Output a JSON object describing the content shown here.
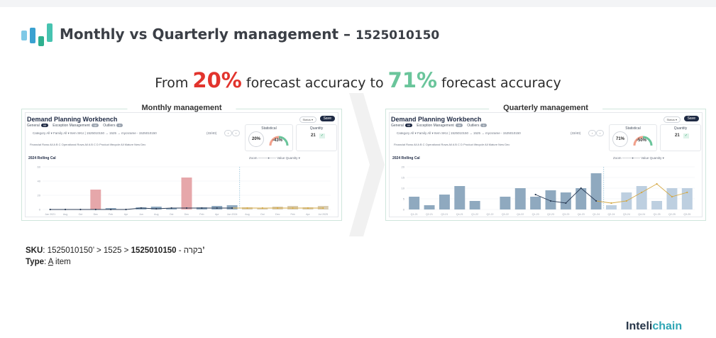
{
  "header": {
    "title": "Monthly vs Quarterly management –",
    "sku_number": "1525010150"
  },
  "headline": {
    "prefix": "From",
    "from_value": "20%",
    "middle": "forecast accuracy to",
    "to_value": "71%",
    "suffix": "forecast accuracy"
  },
  "colors": {
    "logo": [
      "#7fc9e6",
      "#3aa1d0",
      "#2fb08f",
      "#47c3b0"
    ],
    "red": "#e2342d",
    "green": "#6ac59b",
    "bar_blue": "#8fa9bf",
    "bar_red": "#e6a7aa",
    "bar_tan": "#d9cdb2",
    "line_dark": "#2b3d57",
    "line_gold": "#d4a843"
  },
  "panels": [
    {
      "label": "Monthly management",
      "wb_title": "Demand Planning Workbench",
      "tabs": [
        "General",
        "Exception Management",
        "Outliers"
      ],
      "tab_counts": [
        "99",
        "18",
        "6"
      ],
      "filter_row": "Category  All ▾      Family  All ▾      Item  SKU | 1525010150 → 1525 → mycsrame - 1525010150",
      "pager": "(33/40)",
      "hierarchy_row": "Financial Rows   All   A   B   C      Operational Rows   All   A   B   C   D      Product lifecycle   All   Mature   New   Dec",
      "chart_row": "2024   Rolling   Cal",
      "right_row": "Zoom   ———●——     Value Quantity ▾",
      "stat_title": "Statistical",
      "stat_value": "20%",
      "bias_value": "-43%",
      "qty_title": "Quantity",
      "qty_value": "21",
      "button": "Save",
      "x_ticks": [
        "Jan 2021",
        "Aug",
        "Oct",
        "Dec",
        "Feb",
        "Apr",
        "Jun",
        "Aug",
        "Oct",
        "Dec",
        "Feb",
        "Apr",
        "Jun 2024",
        "Aug",
        "Oct",
        "Dec",
        "Feb",
        "Apr",
        "Jul 2025"
      ],
      "y_ticks": [
        "60",
        "40",
        "20",
        "0"
      ]
    },
    {
      "label": "Quarterly management",
      "wb_title": "Demand Planning Workbench",
      "tabs": [
        "General",
        "Exception Management",
        "Outliers"
      ],
      "tab_counts": [
        "99",
        "18",
        "6"
      ],
      "filter_row": "Category  All ▾      Family  All ▾      Item  SKU | 1525010150 → 1525 → mycsrame - 1525010150",
      "pager": "(33/40)",
      "hierarchy_row": "Financial Rows   All   A   B   C      Operational Rows   All   A   B   C   D      Product lifecycle   All   Mature   New   Dec",
      "chart_row": "2024   Rolling   Cal",
      "right_row": "Zoom   ———●——     Value Quantity ▾",
      "stat_title": "Statistical",
      "stat_value": "71%",
      "bias_value": "-50%",
      "qty_title": "Quantity",
      "qty_value": "21",
      "button": "Save",
      "x_ticks": [
        "Q1-21",
        "Q2-21",
        "Q3-21",
        "Q4-21",
        "Q1-22",
        "Q2-22",
        "Q3-22",
        "Q4-22",
        "Q1-23",
        "Q2-23",
        "Q3-23",
        "Q4-23",
        "Q1-24",
        "Q2-24",
        "Q3-24",
        "Q4-24",
        "Q1-25",
        "Q2-25",
        "Q3-25"
      ],
      "y_ticks": [
        "20",
        "15",
        "10",
        "5",
        "0"
      ]
    }
  ],
  "info": {
    "sku_label": "SKU",
    "sku_value": ": 1525010150’ > 1525 > בקרה - ",
    "sku_bold": "1525010150’",
    "type_label": "Type",
    "type_letter": "A",
    "type_value": " item"
  },
  "brand": {
    "part1": "Inteli",
    "part2": "chain"
  },
  "chart_data": [
    {
      "type": "bar",
      "title": "Monthly management",
      "x": [
        "Jan 2021",
        "Aug",
        "Oct",
        "Dec",
        "Feb",
        "Apr",
        "Jun",
        "Aug",
        "Oct",
        "Dec",
        "Feb",
        "Apr",
        "Jun 2024",
        "Aug",
        "Oct",
        "Dec",
        "Feb",
        "Apr",
        "Jul 2025"
      ],
      "series": [
        {
          "name": "Actual",
          "values": [
            0,
            0,
            0,
            28,
            2,
            0,
            3,
            4,
            2,
            45,
            3,
            5,
            6,
            3,
            2,
            4,
            5,
            3,
            5
          ]
        },
        {
          "name": "Forecast",
          "values": [
            0,
            0,
            0,
            0,
            0,
            0,
            2,
            1,
            2,
            2,
            2,
            2,
            2,
            2,
            2,
            2,
            2,
            2,
            2
          ]
        }
      ],
      "ylim": [
        0,
        60
      ]
    },
    {
      "type": "bar",
      "title": "Quarterly management",
      "x": [
        "Q1-21",
        "Q2-21",
        "Q3-21",
        "Q4-21",
        "Q1-22",
        "Q2-22",
        "Q3-22",
        "Q4-22",
        "Q1-23",
        "Q2-23",
        "Q3-23",
        "Q4-23",
        "Q1-24",
        "Q2-24",
        "Q3-24",
        "Q4-24",
        "Q1-25",
        "Q2-25",
        "Q3-25"
      ],
      "series": [
        {
          "name": "Actual",
          "values": [
            6,
            2,
            7,
            11,
            4,
            0,
            6,
            10,
            6,
            9,
            8,
            10,
            17,
            2,
            8,
            11,
            4,
            10,
            10
          ]
        },
        {
          "name": "Forecast",
          "values": [
            null,
            null,
            null,
            null,
            null,
            null,
            null,
            null,
            7,
            4,
            3,
            10,
            4,
            3,
            4,
            8,
            12,
            6,
            8
          ]
        }
      ],
      "ylim": [
        0,
        20
      ]
    }
  ]
}
